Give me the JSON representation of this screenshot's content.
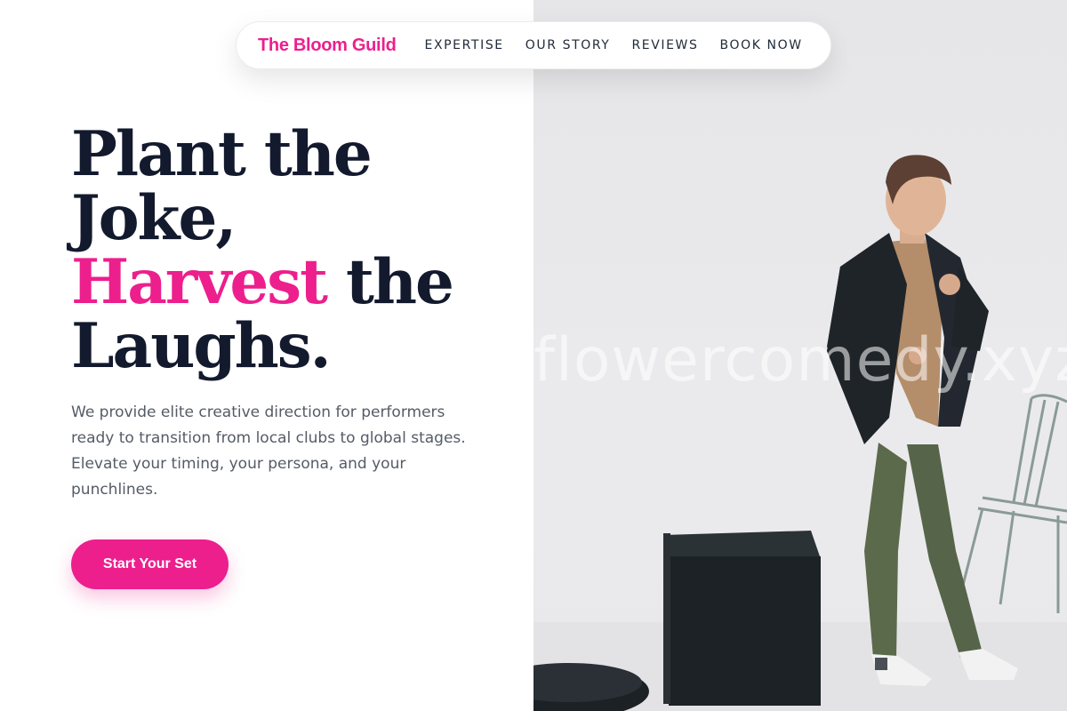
{
  "brand": {
    "name": "The Bloom Guild"
  },
  "nav": {
    "links": [
      {
        "label": "EXPERTISE"
      },
      {
        "label": "OUR STORY"
      },
      {
        "label": "REVIEWS"
      },
      {
        "label": "BOOK NOW"
      }
    ]
  },
  "hero": {
    "title_line1": "Plant the",
    "title_line2": "Joke,",
    "title_accent": "Harvest",
    "title_line3_rest": " the",
    "title_line4": "Laughs.",
    "description": "We provide elite creative direction for performers ready to transition from local clubs to global stages. Elevate your timing, your persona, and your punchlines.",
    "cta_label": "Start Your Set"
  },
  "photo": {
    "watermark": "flowercomedy.xyz",
    "subject": "man in dark blazer and green trousers in a bright studio"
  },
  "colors": {
    "accent": "#ec1f8d",
    "heading": "#131a2e",
    "body_text": "#555b66",
    "photo_bg": "#e7e7e9"
  }
}
